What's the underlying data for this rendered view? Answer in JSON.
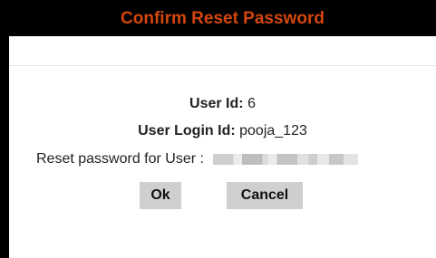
{
  "dialog": {
    "title": "Confirm Reset Password",
    "user_id_label": "User Id:",
    "user_id_value": "6",
    "user_login_label": "User Login Id:",
    "user_login_value": "pooja_123",
    "reset_for_label": "Reset password for User :",
    "ok_label": "Ok",
    "cancel_label": "Cancel"
  },
  "colors": {
    "title_bar": "#000000",
    "title_text": "#d3460d",
    "button_bg": "#cfcfcf"
  }
}
